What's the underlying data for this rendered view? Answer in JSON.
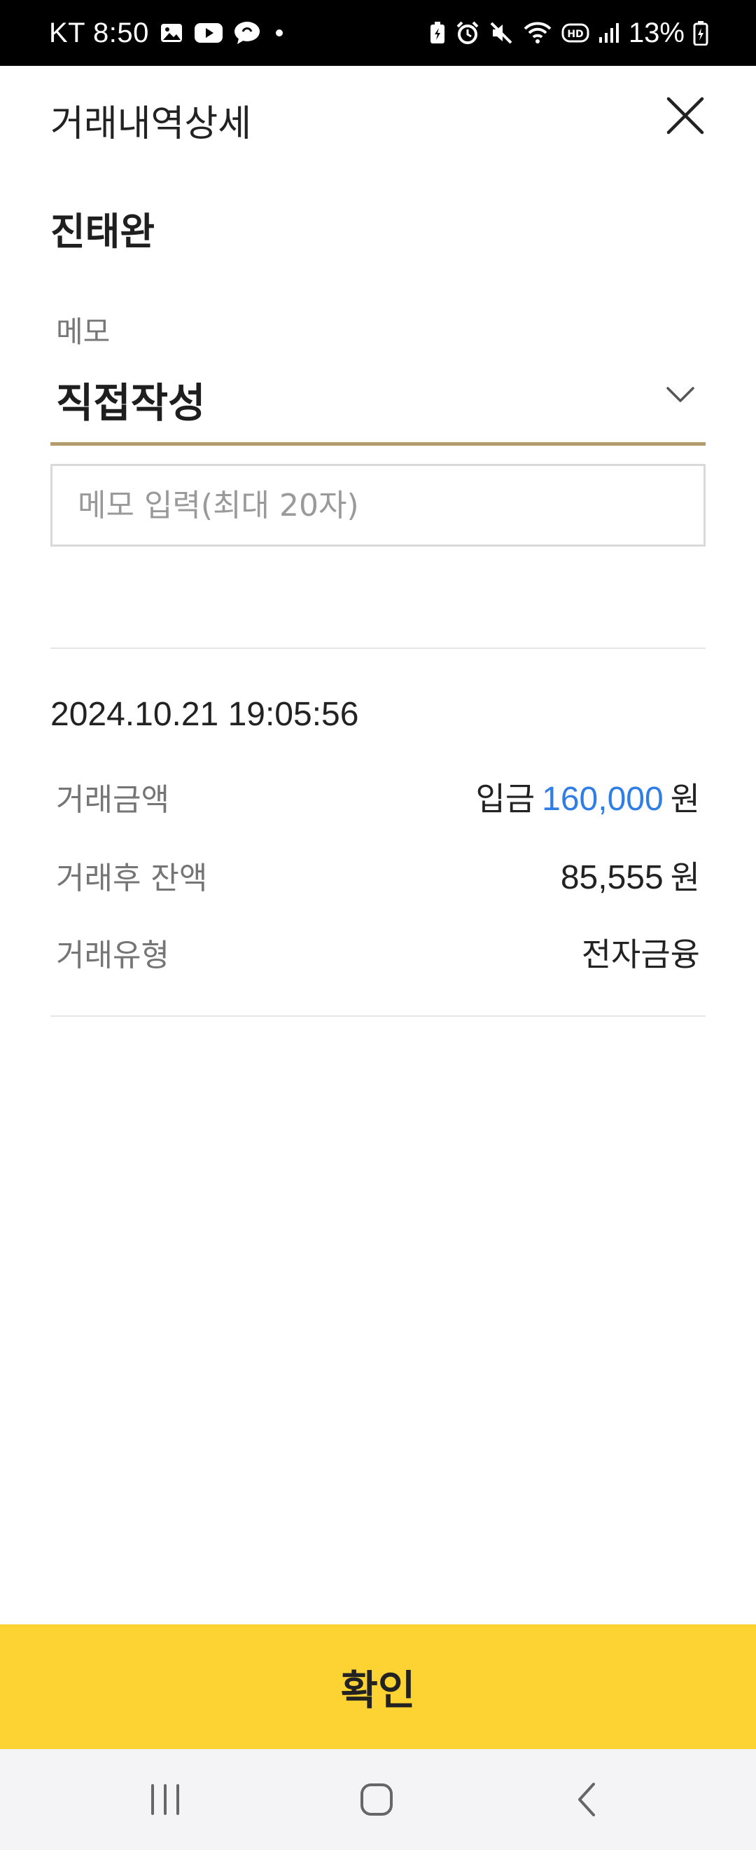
{
  "status_bar": {
    "carrier_time": "KT 8:50",
    "battery": "13%",
    "left_icons": [
      "gallery-icon",
      "youtube-icon",
      "chat-icon",
      "dot-icon"
    ],
    "right_icons": [
      "battery-saver-icon",
      "alarm-icon",
      "mute-icon",
      "wifi-icon",
      "hd-icon",
      "signal-icon",
      "battery-icon"
    ]
  },
  "header": {
    "title": "거래내역상세",
    "close_icon": "close-icon"
  },
  "account": {
    "name": "진태완"
  },
  "memo": {
    "label": "메모",
    "selected": "직접작성",
    "placeholder": "메모 입력(최대 20자)",
    "value": ""
  },
  "transaction": {
    "datetime": "2024.10.21 19:05:56",
    "rows": [
      {
        "label": "거래금액",
        "prefix": "입금",
        "amount": "160,000",
        "unit": "원"
      },
      {
        "label": "거래후 잔액",
        "amount": "85,555",
        "unit": "원"
      },
      {
        "label": "거래유형",
        "value": "전자금융"
      }
    ]
  },
  "confirm": {
    "label": "확인"
  },
  "colors": {
    "accent_yellow": "#fdd233",
    "underline_gold": "#b49a6c",
    "amount_blue": "#2f7ee6"
  }
}
